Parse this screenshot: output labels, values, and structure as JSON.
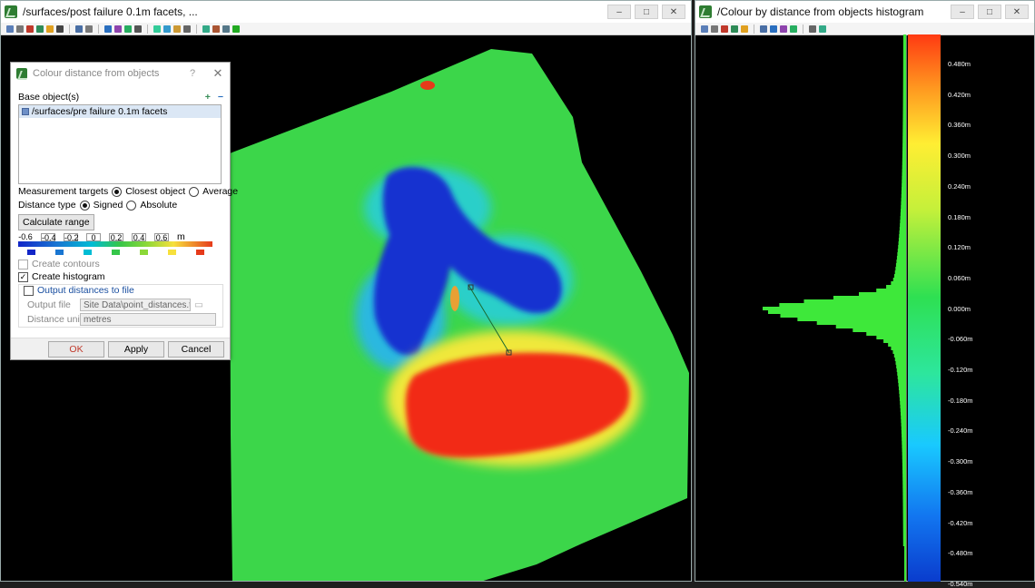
{
  "left_window": {
    "title": "/surfaces/post failure 0.1m facets, ...",
    "buttons": {
      "minimize": "–",
      "maximize": "□",
      "close": "✕"
    }
  },
  "right_window": {
    "title": "/Colour by distance from objects histogram",
    "buttons": {
      "minimize": "–",
      "maximize": "□",
      "close": "✕"
    }
  },
  "dialog": {
    "title": "Colour distance from objects",
    "help": "?",
    "close": "✕",
    "base_objects_label": "Base object(s)",
    "add_icon": "+",
    "remove_icon": "−",
    "base_objects": [
      "/surfaces/pre failure 0.1m facets"
    ],
    "measurement_targets_label": "Measurement targets",
    "measurement_options": [
      "Closest object",
      "Average"
    ],
    "measurement_selected": "Closest object",
    "distance_type_label": "Distance type",
    "distance_type_options": [
      "Signed",
      "Absolute"
    ],
    "distance_type_selected": "Signed",
    "calculate_range_label": "Calculate range",
    "scale_values": [
      "-0.6",
      "-0.4",
      "-0.2",
      "0",
      "0.2",
      "0.4",
      "0.6"
    ],
    "scale_unit": "m",
    "swatch_colors": [
      "#1226c8",
      "#1976d2",
      "#00bcd4",
      "#35c64a",
      "#8bd838",
      "#f7e03c",
      "#e63a1a"
    ],
    "create_contours_label": "Create contours",
    "create_contours_checked": false,
    "create_histogram_label": "Create histogram",
    "create_histogram_checked": true,
    "output_distances_label": "Output distances to file",
    "output_distances_checked": false,
    "output_file_label": "Output file",
    "output_file_value": "Site Data\\point_distances.txt",
    "distance_unit_label": "Distance unit",
    "distance_unit_value": "metres",
    "ok_label": "OK",
    "apply_label": "Apply",
    "cancel_label": "Cancel"
  },
  "histogram": {
    "ticks": [
      "0.480m",
      "0.420m",
      "0.360m",
      "0.300m",
      "0.240m",
      "0.180m",
      "0.120m",
      "0.060m",
      "0.000m",
      "-0.060m",
      "-0.120m",
      "-0.180m",
      "-0.240m",
      "-0.300m",
      "-0.360m",
      "-0.420m",
      "-0.480m",
      "-0.540m"
    ],
    "colors": {
      "top": "#ff3b1a",
      "mid_high": "#ffee33",
      "zero": "#2ee052",
      "mid_low": "#19c9ff",
      "bottom": "#0a3ccd"
    }
  }
}
